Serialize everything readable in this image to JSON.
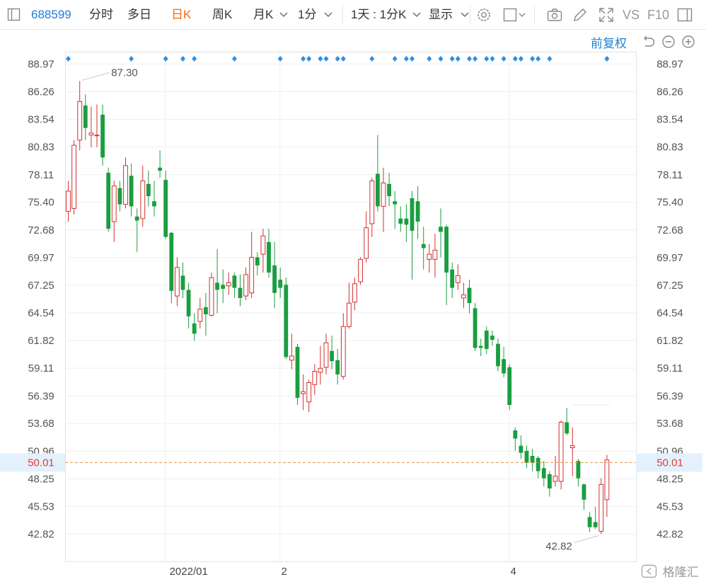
{
  "toolbar": {
    "code": "688599",
    "tabs": [
      "分时",
      "多日",
      "日K",
      "周K",
      "月K",
      "1分",
      "1天 : 1分K",
      "显示"
    ],
    "active_tab": "日K",
    "vs_label": "VS",
    "f10_label": "F10"
  },
  "restore_label": "前复权",
  "watermark": "格隆汇",
  "colors": {
    "up": "#d42f2f",
    "down": "#1a9e3f",
    "accent": "#1f7fd6",
    "active_tab": "#f06a15",
    "current_price_line": "#e39a4b"
  },
  "chart_data": {
    "type": "candlestick",
    "y_ticks": [
      "88.97",
      "86.26",
      "83.54",
      "80.83",
      "78.11",
      "75.40",
      "72.68",
      "69.97",
      "67.25",
      "64.54",
      "61.82",
      "59.11",
      "56.39",
      "53.68",
      "50.96",
      "48.25",
      "45.53",
      "42.82"
    ],
    "ylim": [
      42.82,
      88.97
    ],
    "x_ticks": [
      {
        "label": "2022/01",
        "index": 17
      },
      {
        "label": "2",
        "index": 37
      },
      {
        "label": "4",
        "index": 77
      }
    ],
    "current_price": "50.01",
    "high_label": "87.30",
    "low_label": "42.82",
    "marker_indices": [
      0,
      11,
      17,
      20,
      22,
      29,
      37,
      41,
      42,
      44,
      45,
      47,
      48,
      53,
      57,
      59,
      60,
      63,
      65,
      67,
      68,
      70,
      71,
      73,
      74,
      76,
      78,
      79,
      81,
      82,
      84,
      94
    ],
    "candles": [
      [
        74.5,
        76.5,
        77.5,
        73.5
      ],
      [
        74.8,
        81.0,
        81.5,
        74.2
      ],
      [
        81.5,
        85.3,
        87.3,
        80.5
      ],
      [
        84.9,
        82.7,
        86.0,
        81.5
      ],
      [
        82.0,
        82.2,
        84.8,
        80.8
      ],
      [
        82.0,
        82.0,
        85.0,
        80.8
      ],
      [
        84.0,
        79.8,
        85.0,
        79.0
      ],
      [
        78.3,
        72.8,
        78.8,
        72.5
      ],
      [
        73.5,
        77.0,
        77.5,
        71.5
      ],
      [
        76.8,
        75.2,
        77.5,
        74.5
      ],
      [
        75.2,
        79.0,
        79.8,
        74.8
      ],
      [
        78.0,
        75.0,
        79.2,
        74.0
      ],
      [
        74.0,
        73.6,
        74.8,
        70.5
      ],
      [
        73.8,
        77.5,
        79.0,
        73.0
      ],
      [
        77.2,
        76.0,
        78.5,
        75.0
      ],
      [
        75.5,
        75.0,
        77.5,
        74.0
      ],
      [
        78.8,
        78.5,
        80.5,
        77.8
      ],
      [
        77.6,
        72.0,
        78.5,
        71.8
      ],
      [
        72.4,
        66.7,
        72.5,
        65.5
      ],
      [
        66.2,
        69.0,
        70.0,
        65.2
      ],
      [
        68.2,
        66.8,
        69.5,
        66.0
      ],
      [
        66.8,
        64.2,
        67.5,
        63.0
      ],
      [
        63.5,
        62.5,
        64.5,
        61.8
      ],
      [
        63.7,
        64.9,
        66.0,
        63.0
      ],
      [
        65.1,
        64.4,
        66.5,
        62.3
      ],
      [
        64.3,
        68.0,
        68.5,
        64.2
      ],
      [
        67.5,
        66.8,
        70.8,
        64.5
      ],
      [
        67.3,
        66.9,
        68.8,
        65.5
      ],
      [
        67.2,
        67.5,
        68.5,
        66.3
      ],
      [
        68.2,
        67.0,
        68.5,
        66.0
      ],
      [
        67.0,
        66.0,
        68.3,
        65.2
      ],
      [
        66.2,
        68.3,
        69.0,
        65.8
      ],
      [
        66.5,
        70.0,
        72.5,
        66.0
      ],
      [
        70.0,
        69.2,
        70.5,
        68.2
      ],
      [
        70.3,
        72.1,
        72.8,
        68.5
      ],
      [
        71.5,
        68.5,
        72.8,
        68.0
      ],
      [
        69.2,
        66.5,
        71.5,
        65.0
      ],
      [
        67.8,
        67.0,
        69.0,
        66.0
      ],
      [
        67.3,
        60.2,
        68.0,
        60.0
      ],
      [
        59.9,
        60.3,
        62.5,
        59.0
      ],
      [
        61.2,
        56.2,
        61.5,
        55.5
      ],
      [
        56.6,
        56.8,
        58.5,
        55.0
      ],
      [
        55.8,
        57.7,
        58.0,
        54.8
      ],
      [
        57.5,
        58.8,
        59.5,
        56.5
      ],
      [
        58.7,
        59.1,
        61.3,
        57.5
      ],
      [
        59.2,
        61.6,
        62.5,
        58.5
      ],
      [
        60.8,
        59.8,
        62.3,
        59.0
      ],
      [
        59.9,
        58.5,
        61.0,
        57.5
      ],
      [
        58.3,
        63.2,
        64.5,
        58.0
      ],
      [
        63.2,
        65.5,
        67.5,
        63.0
      ],
      [
        65.6,
        67.4,
        68.0,
        64.8
      ],
      [
        67.6,
        69.8,
        70.0,
        67.3
      ],
      [
        69.9,
        72.9,
        74.5,
        69.5
      ],
      [
        73.3,
        77.5,
        77.8,
        72.0
      ],
      [
        78.2,
        75.0,
        82.0,
        74.5
      ],
      [
        75.0,
        77.3,
        78.8,
        72.5
      ],
      [
        77.2,
        76.0,
        78.3,
        75.0
      ],
      [
        75.5,
        75.2,
        76.5,
        72.8
      ],
      [
        73.8,
        73.3,
        75.0,
        72.5
      ],
      [
        73.8,
        73.2,
        75.2,
        71.5
      ],
      [
        75.8,
        72.6,
        76.5,
        67.8
      ],
      [
        75.5,
        73.5,
        77.0,
        71.8
      ],
      [
        71.3,
        70.9,
        73.0,
        68.8
      ],
      [
        69.8,
        70.3,
        71.3,
        68.5
      ],
      [
        69.8,
        70.7,
        72.3,
        68.0
      ],
      [
        73.0,
        72.5,
        74.8,
        70.0
      ],
      [
        73.0,
        68.5,
        73.2,
        65.3
      ],
      [
        68.8,
        67.0,
        69.5,
        66.0
      ],
      [
        67.5,
        68.2,
        69.3,
        66.8
      ],
      [
        66.0,
        66.3,
        67.5,
        65.0
      ],
      [
        67.0,
        65.5,
        67.8,
        64.5
      ],
      [
        65.0,
        61.1,
        65.5,
        60.8
      ],
      [
        61.3,
        61.1,
        62.0,
        60.3
      ],
      [
        62.8,
        61.0,
        63.2,
        60.5
      ],
      [
        62.3,
        61.9,
        62.8,
        61.3
      ],
      [
        61.5,
        59.3,
        62.0,
        58.8
      ],
      [
        60.0,
        58.6,
        61.2,
        58.2
      ],
      [
        59.2,
        55.5,
        59.5,
        55.0
      ],
      [
        53.0,
        52.2,
        53.3,
        51.0
      ],
      [
        51.5,
        50.8,
        52.5,
        50.2
      ],
      [
        51.0,
        49.8,
        51.5,
        49.3
      ],
      [
        50.5,
        49.8,
        51.2,
        49.0
      ],
      [
        50.3,
        49.0,
        50.5,
        48.3
      ],
      [
        49.3,
        48.3,
        50.0,
        47.5
      ],
      [
        48.7,
        47.3,
        49.0,
        46.5
      ],
      [
        48.0,
        48.5,
        50.5,
        47.5
      ],
      [
        48.0,
        53.8,
        54.0,
        47.2
      ],
      [
        53.8,
        52.7,
        55.2,
        52.5
      ],
      [
        51.3,
        51.5,
        53.3,
        48.5
      ],
      [
        50.0,
        48.3,
        50.2,
        47.5
      ],
      [
        47.7,
        46.2,
        47.8,
        45.2
      ],
      [
        44.5,
        43.5,
        45.0,
        43.0
      ],
      [
        44.0,
        43.5,
        45.5,
        43.3
      ],
      [
        43.1,
        47.7,
        48.3,
        42.82
      ],
      [
        46.2,
        50.1,
        50.6,
        44.5
      ]
    ]
  }
}
